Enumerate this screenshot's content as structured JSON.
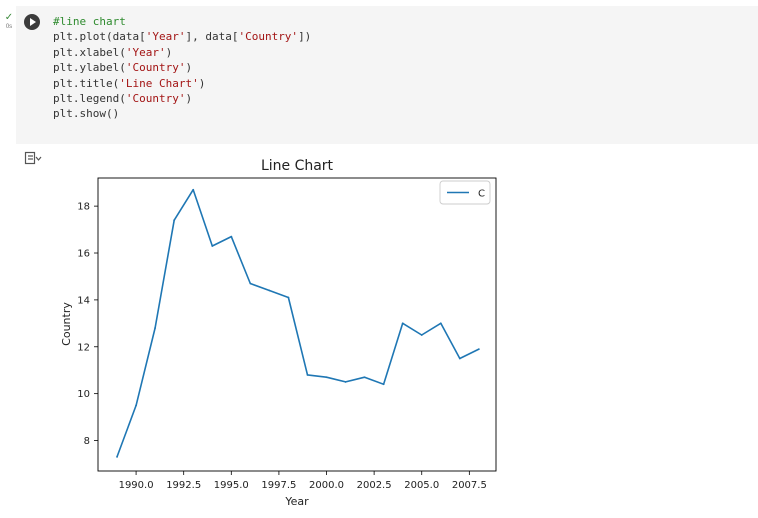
{
  "cell": {
    "exec_check": "✓",
    "exec_time": "0s",
    "code_lines": [
      [
        {
          "t": "#line chart",
          "c": "comment"
        }
      ],
      [
        {
          "t": "plt.plot(data[",
          "c": ""
        },
        {
          "t": "'Year'",
          "c": "str"
        },
        {
          "t": "], data[",
          "c": ""
        },
        {
          "t": "'Country'",
          "c": "str"
        },
        {
          "t": "])",
          "c": ""
        }
      ],
      [
        {
          "t": "plt.xlabel(",
          "c": ""
        },
        {
          "t": "'Year'",
          "c": "str"
        },
        {
          "t": ")",
          "c": ""
        }
      ],
      [
        {
          "t": "plt.ylabel(",
          "c": ""
        },
        {
          "t": "'Country'",
          "c": "str"
        },
        {
          "t": ")",
          "c": ""
        }
      ],
      [
        {
          "t": "plt.title(",
          "c": ""
        },
        {
          "t": "'Line Chart'",
          "c": "str"
        },
        {
          "t": ")",
          "c": ""
        }
      ],
      [
        {
          "t": "plt.legend(",
          "c": ""
        },
        {
          "t": "'Country'",
          "c": "str"
        },
        {
          "t": ")",
          "c": ""
        }
      ],
      [
        {
          "t": "plt.show()",
          "c": ""
        }
      ]
    ]
  },
  "colors": {
    "line": "#1f77b4",
    "axis": "#000000",
    "text": "#222222"
  },
  "chart_data": {
    "type": "line",
    "title": "Line Chart",
    "xlabel": "Year",
    "ylabel": "Country",
    "xlim": [
      1988.0,
      2008.9
    ],
    "ylim": [
      6.7,
      19.2
    ],
    "xticks": [
      1990.0,
      1992.5,
      1995.0,
      1997.5,
      2000.0,
      2002.5,
      2005.0,
      2007.5
    ],
    "xtick_labels": [
      "1990.0",
      "1992.5",
      "1995.0",
      "1997.5",
      "2000.0",
      "2002.5",
      "2005.0",
      "2007.5"
    ],
    "yticks": [
      8,
      10,
      12,
      14,
      16,
      18
    ],
    "ytick_labels": [
      "8",
      "10",
      "12",
      "14",
      "16",
      "18"
    ],
    "grid": false,
    "legend_position": "top-right",
    "legend_entries": [
      "C"
    ],
    "series": [
      {
        "name": "C",
        "x": [
          1989,
          1990,
          1991,
          1992,
          1993,
          1994,
          1995,
          1996,
          1997,
          1998,
          1999,
          2000,
          2001,
          2002,
          2003,
          2004,
          2005,
          2006,
          2007,
          2008
        ],
        "values": [
          7.3,
          9.5,
          12.8,
          17.4,
          18.7,
          16.3,
          16.7,
          14.7,
          14.4,
          14.1,
          10.8,
          10.7,
          10.5,
          10.7,
          10.4,
          13.0,
          12.5,
          13.0,
          11.5,
          11.9
        ]
      }
    ]
  }
}
